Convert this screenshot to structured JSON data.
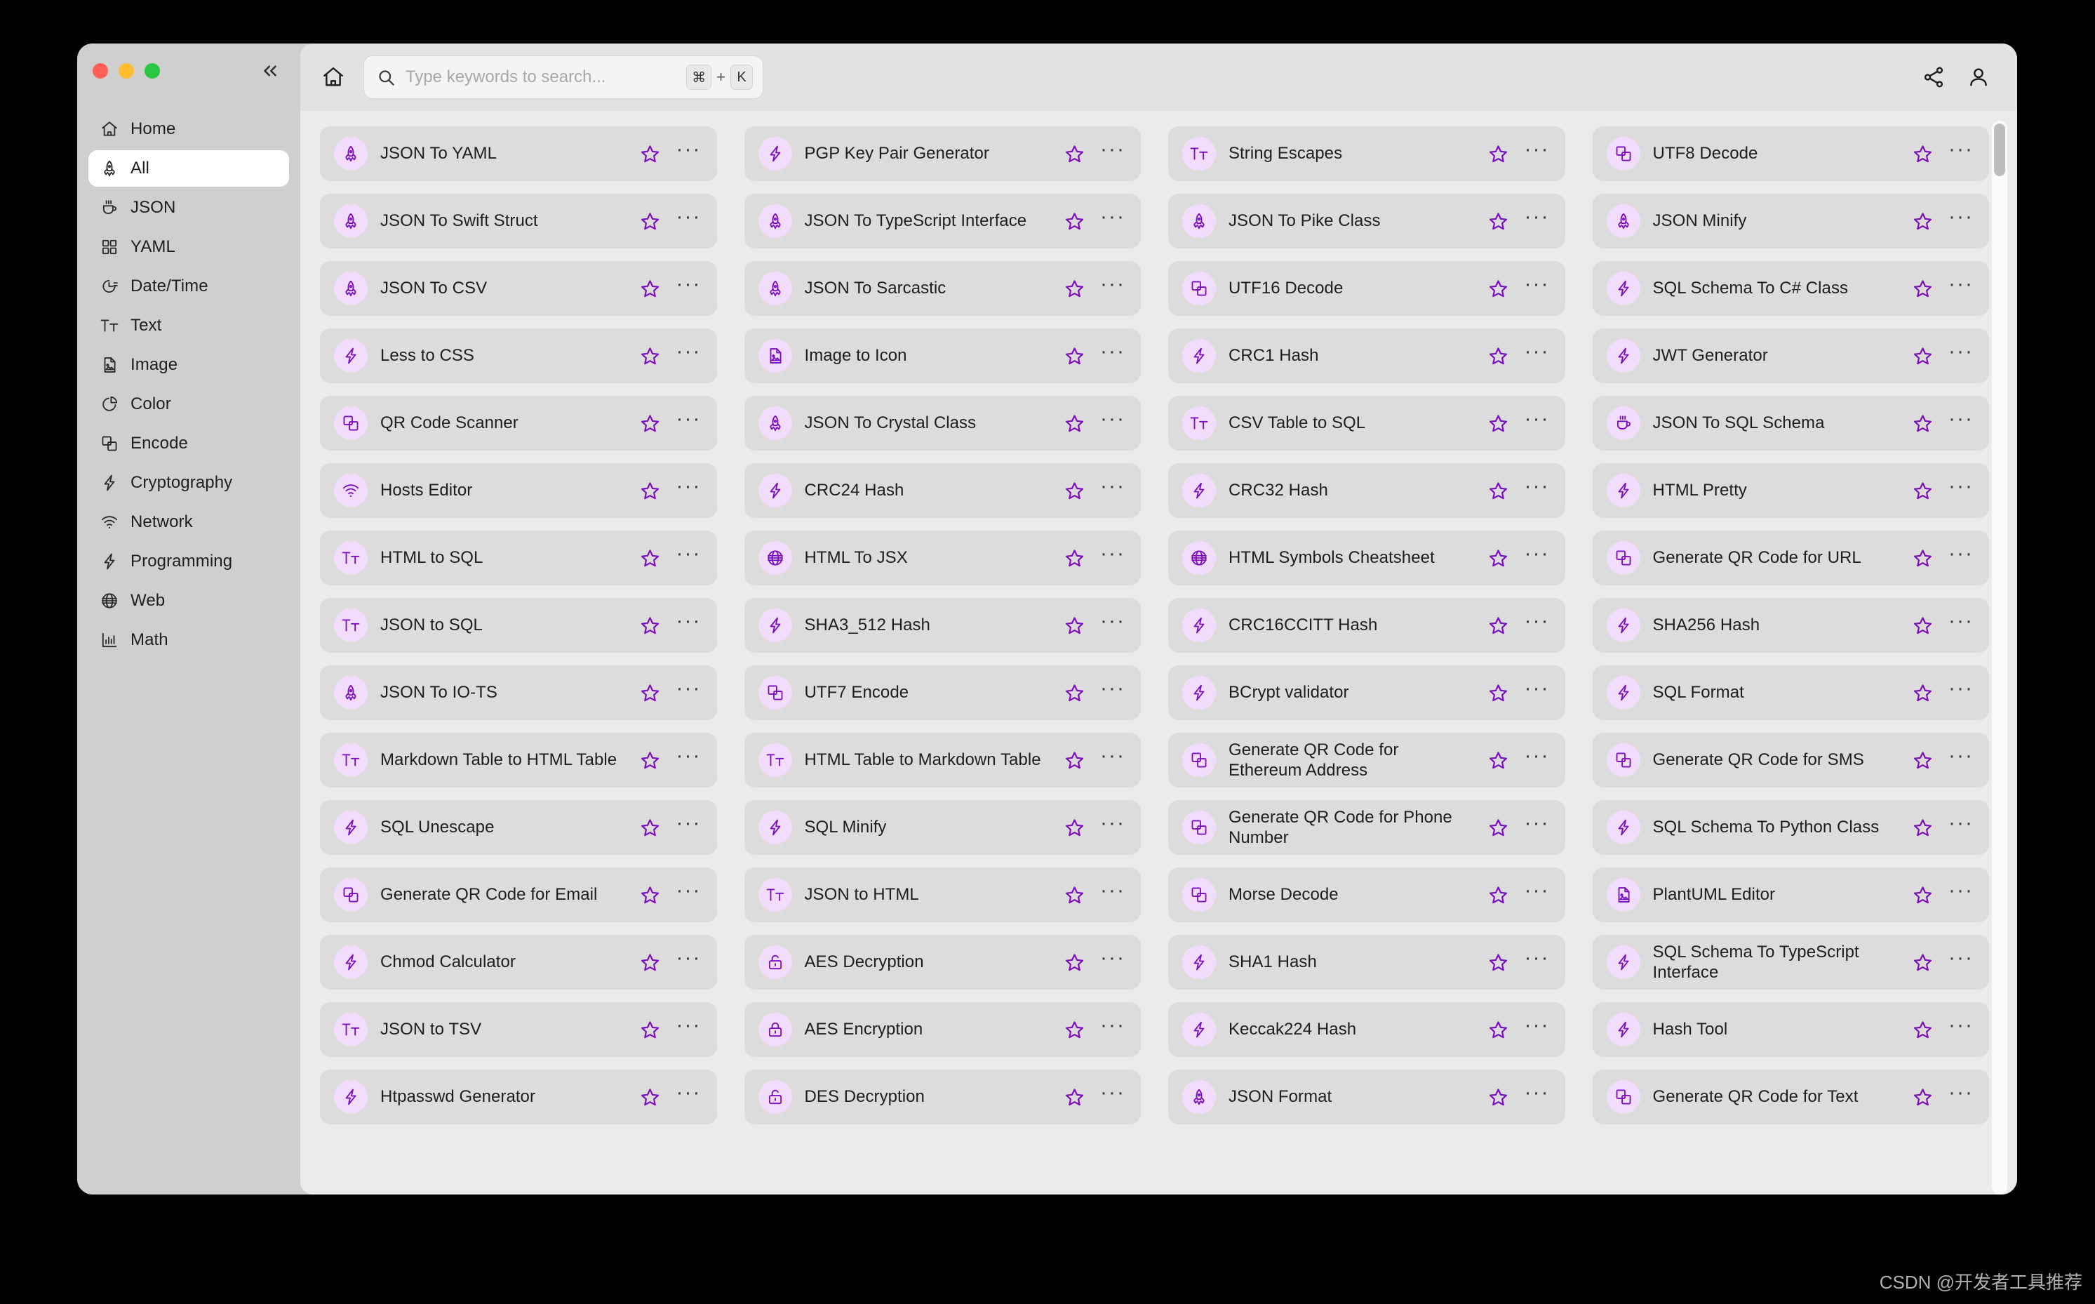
{
  "window": {
    "traffic_lights": {
      "close": "close-button",
      "minimize": "minimize-button",
      "maximize": "maximize-button"
    },
    "collapse_label": "«"
  },
  "sidebar": {
    "items": [
      {
        "label": "Home",
        "icon": "home-icon",
        "active": false
      },
      {
        "label": "All",
        "icon": "rocket-icon",
        "active": true
      },
      {
        "label": "JSON",
        "icon": "coffee-icon",
        "active": false
      },
      {
        "label": "YAML",
        "icon": "grid-icon",
        "active": false
      },
      {
        "label": "Date/Time",
        "icon": "clock-icon",
        "active": false
      },
      {
        "label": "Text",
        "icon": "text-icon",
        "active": false
      },
      {
        "label": "Image",
        "icon": "image-file-icon",
        "active": false
      },
      {
        "label": "Color",
        "icon": "pie-icon",
        "active": false
      },
      {
        "label": "Encode",
        "icon": "layers-icon",
        "active": false
      },
      {
        "label": "Cryptography",
        "icon": "bolt-icon",
        "active": false
      },
      {
        "label": "Network",
        "icon": "wifi-icon",
        "active": false
      },
      {
        "label": "Programming",
        "icon": "bolt-icon",
        "active": false
      },
      {
        "label": "Web",
        "icon": "globe-icon",
        "active": false
      },
      {
        "label": "Math",
        "icon": "chart-icon",
        "active": false
      }
    ]
  },
  "topbar": {
    "home_icon": "home-icon",
    "share_icon": "share-icon",
    "account_icon": "user-icon",
    "search": {
      "placeholder": "Type keywords to search...",
      "value": "",
      "shortcut_modifier": "⌘",
      "shortcut_plus": "+",
      "shortcut_key": "K"
    }
  },
  "content": {
    "more_glyph": "···",
    "columns": [
      [
        {
          "title": "JSON To YAML",
          "icon": "rocket-icon"
        },
        {
          "title": "JSON To Swift Struct",
          "icon": "rocket-icon"
        },
        {
          "title": "JSON To CSV",
          "icon": "rocket-icon"
        },
        {
          "title": "Less to CSS",
          "icon": "bolt-icon"
        },
        {
          "title": "QR Code Scanner",
          "icon": "layers-icon"
        },
        {
          "title": "Hosts Editor",
          "icon": "wifi-icon"
        },
        {
          "title": "HTML to SQL",
          "icon": "text-icon"
        },
        {
          "title": "JSON to SQL",
          "icon": "text-icon"
        },
        {
          "title": "JSON To IO-TS",
          "icon": "rocket-icon"
        },
        {
          "title": "Markdown Table to HTML Table",
          "icon": "text-icon"
        },
        {
          "title": "SQL Unescape",
          "icon": "bolt-icon"
        },
        {
          "title": "Generate QR Code for Email",
          "icon": "layers-icon"
        },
        {
          "title": "Chmod Calculator",
          "icon": "bolt-icon"
        },
        {
          "title": "JSON to TSV",
          "icon": "text-icon"
        },
        {
          "title": "Htpasswd Generator",
          "icon": "bolt-icon"
        }
      ],
      [
        {
          "title": "PGP Key Pair Generator",
          "icon": "bolt-icon"
        },
        {
          "title": "JSON To TypeScript Interface",
          "icon": "rocket-icon"
        },
        {
          "title": "JSON To Sarcastic",
          "icon": "rocket-icon"
        },
        {
          "title": "Image to Icon",
          "icon": "image-file-icon"
        },
        {
          "title": "JSON To Crystal Class",
          "icon": "rocket-icon"
        },
        {
          "title": "CRC24 Hash",
          "icon": "bolt-icon"
        },
        {
          "title": "HTML To JSX",
          "icon": "globe-icon"
        },
        {
          "title": "SHA3_512 Hash",
          "icon": "bolt-icon"
        },
        {
          "title": "UTF7 Encode",
          "icon": "layers-icon"
        },
        {
          "title": "HTML Table to Markdown Table",
          "icon": "text-icon"
        },
        {
          "title": "SQL Minify",
          "icon": "bolt-icon"
        },
        {
          "title": "JSON to HTML",
          "icon": "text-icon"
        },
        {
          "title": "AES Decryption",
          "icon": "unlock-icon"
        },
        {
          "title": "AES Encryption",
          "icon": "lock-icon"
        },
        {
          "title": "DES Decryption",
          "icon": "unlock-icon"
        }
      ],
      [
        {
          "title": "String Escapes",
          "icon": "text-icon"
        },
        {
          "title": "JSON To Pike Class",
          "icon": "rocket-icon"
        },
        {
          "title": "UTF16 Decode",
          "icon": "layers-icon"
        },
        {
          "title": "CRC1 Hash",
          "icon": "bolt-icon"
        },
        {
          "title": "CSV Table to SQL",
          "icon": "text-icon"
        },
        {
          "title": "CRC32 Hash",
          "icon": "bolt-icon"
        },
        {
          "title": "HTML Symbols Cheatsheet",
          "icon": "globe-icon"
        },
        {
          "title": "CRC16CCITT Hash",
          "icon": "bolt-icon"
        },
        {
          "title": "BCrypt validator",
          "icon": "bolt-icon"
        },
        {
          "title": "Generate QR Code for Ethereum Address",
          "icon": "layers-icon"
        },
        {
          "title": "Generate QR Code for Phone Number",
          "icon": "layers-icon"
        },
        {
          "title": "Morse Decode",
          "icon": "layers-icon"
        },
        {
          "title": "SHA1 Hash",
          "icon": "bolt-icon"
        },
        {
          "title": "Keccak224 Hash",
          "icon": "bolt-icon"
        },
        {
          "title": "JSON Format",
          "icon": "rocket-icon"
        }
      ],
      [
        {
          "title": "UTF8 Decode",
          "icon": "layers-icon"
        },
        {
          "title": "JSON Minify",
          "icon": "rocket-icon"
        },
        {
          "title": "SQL Schema To C# Class",
          "icon": "bolt-icon"
        },
        {
          "title": "JWT Generator",
          "icon": "bolt-icon"
        },
        {
          "title": "JSON To SQL Schema",
          "icon": "coffee-icon"
        },
        {
          "title": "HTML Pretty",
          "icon": "bolt-icon"
        },
        {
          "title": "Generate QR Code for URL",
          "icon": "layers-icon"
        },
        {
          "title": "SHA256 Hash",
          "icon": "bolt-icon"
        },
        {
          "title": "SQL Format",
          "icon": "bolt-icon"
        },
        {
          "title": "Generate QR Code for SMS",
          "icon": "layers-icon"
        },
        {
          "title": "SQL Schema To Python Class",
          "icon": "bolt-icon"
        },
        {
          "title": "PlantUML Editor",
          "icon": "image-file-icon"
        },
        {
          "title": "SQL Schema To TypeScript Interface",
          "icon": "bolt-icon"
        },
        {
          "title": "Hash Tool",
          "icon": "bolt-icon"
        },
        {
          "title": "Generate QR Code for Text",
          "icon": "layers-icon"
        }
      ]
    ]
  },
  "watermark": {
    "text": "CSDN @开发者工具推荐"
  },
  "colors": {
    "accent_purple": "#7b0fbd",
    "icon_bg": "#f2dcfb",
    "card_bg": "#dcdcdc",
    "sidebar_bg": "#cfcfcf",
    "main_bg": "#ebebeb",
    "topbar_bg": "#e2e2e4"
  }
}
